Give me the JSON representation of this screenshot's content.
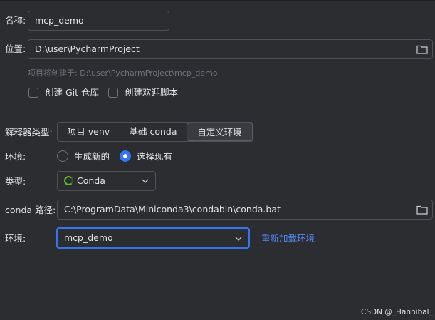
{
  "name_row": {
    "label": "名称:",
    "value": "mcp_demo"
  },
  "location_row": {
    "label": "位置:",
    "value": "D:\\user\\PycharmProject",
    "browse_icon": "folder-icon"
  },
  "location_hint": "项目将创建于: D:\\user\\PycharmProject\\mcp_demo",
  "options": {
    "git_label": "创建 Git 仓库",
    "git_checked": false,
    "welcome_label": "创建欢迎脚本",
    "welcome_checked": false
  },
  "interpreter": {
    "label": "解释器类型:",
    "tabs": [
      "项目 venv",
      "基础 conda",
      "自定义环境"
    ],
    "selected_tab": 2
  },
  "environment_mode": {
    "label": "环境:",
    "option_new": "生成新的",
    "option_existing": "选择现有",
    "selected": "option_existing"
  },
  "type_row": {
    "label": "类型:",
    "value": "Conda",
    "icon": "conda-spinner-icon"
  },
  "conda_path_row": {
    "label": "conda 路径:",
    "value": "C:\\ProgramData\\Miniconda3\\condabin\\conda.bat",
    "browse_icon": "folder-icon"
  },
  "env_row": {
    "label": "环境:",
    "value": "mcp_demo",
    "reload_link": "重新加载环境"
  },
  "colors": {
    "background": "#2b2d30",
    "accent": "#3574f0",
    "link": "#548af7",
    "border": "#4e5157"
  },
  "watermark": "CSDN @_Hannibal_"
}
